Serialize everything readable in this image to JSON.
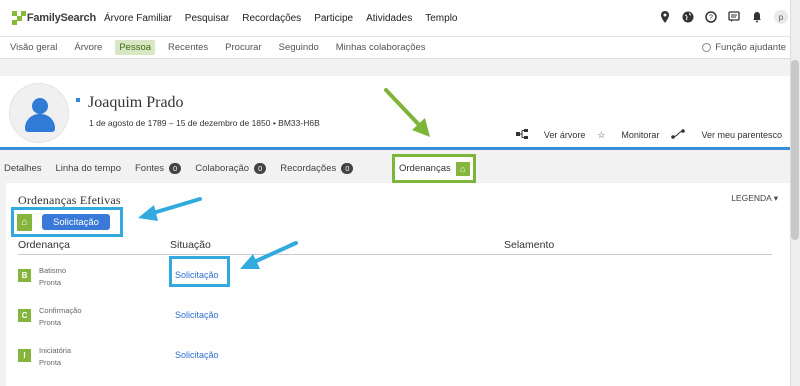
{
  "brand": {
    "name": "FamilySearch",
    "accent": "#87b838"
  },
  "nav_main": [
    "Árvore Familiar",
    "Pesquisar",
    "Recordações",
    "Participe",
    "Atividades",
    "Templo"
  ],
  "user_initial": "p",
  "subnav": {
    "items": [
      "Visão geral",
      "Árvore",
      "Pessoa",
      "Recentes",
      "Procurar",
      "Seguindo",
      "Minhas colaborações"
    ],
    "active": "Pessoa",
    "helper": "Função ajudante"
  },
  "person": {
    "name": "Joaquim Prado",
    "vitals": "1 de agosto de 1789 – 15 de dezembro de 1850 • BM33-H6B",
    "actions": [
      "Ver árvore",
      "Monitorar",
      "Ver meu parentesco"
    ]
  },
  "tabs": [
    {
      "label": "Detalhes",
      "count": null
    },
    {
      "label": "Linha do tempo",
      "count": null
    },
    {
      "label": "Fontes",
      "count": "0"
    },
    {
      "label": "Colaboração",
      "count": "0"
    },
    {
      "label": "Recordações",
      "count": "0"
    }
  ],
  "active_tab": "Ordenanças",
  "section": {
    "title": "Ordenanças Efetivas",
    "legend": "LEGENDA",
    "request_button": "Solicitação",
    "columns": [
      "Ordenança",
      "Situação",
      "Selamento"
    ]
  },
  "ordinances": [
    {
      "letter": "B",
      "name": "Batismo",
      "status": "Pronta",
      "action": "Solicitação"
    },
    {
      "letter": "C",
      "name": "Confirmação",
      "status": "Pronta",
      "action": "Solicitação"
    },
    {
      "letter": "I",
      "name": "Iniciatória",
      "status": "Pronta",
      "action": "Solicitação"
    }
  ],
  "colors": {
    "highlight_green": "#7fb43b",
    "highlight_blue": "#33aadf",
    "link_blue": "#2f6fcf"
  }
}
